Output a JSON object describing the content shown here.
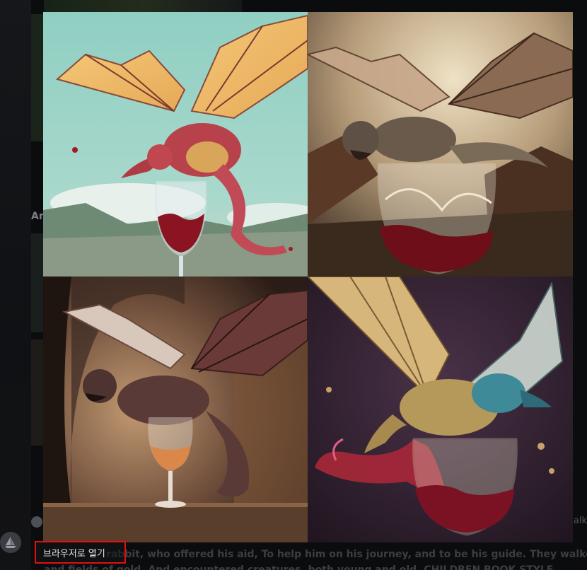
{
  "lightbox": {
    "open_in_browser_label": "브라우저로 열기",
    "images": [
      {
        "icon": "dragon-wine-image-1",
        "accent": "#b83a4a"
      },
      {
        "icon": "dragon-wine-image-2",
        "accent": "#6b5a48"
      },
      {
        "icon": "dragon-wine-image-3",
        "accent": "#5a3a34"
      },
      {
        "icon": "dragon-wine-image-4",
        "accent": "#c9a66b"
      }
    ]
  },
  "background": {
    "side_label": "An",
    "message_line_1": "rabbit, who offered his aid, To help him on his journey, and to be his guide. They walked throu",
    "message_line_2": "and fields of gold. And encountered creatures, both young and old. CHILDREN BOOK STYLE",
    "right_fragment": "alk"
  },
  "colors": {
    "highlight_border": "#e01010",
    "backdrop": "#0b0c0e"
  }
}
